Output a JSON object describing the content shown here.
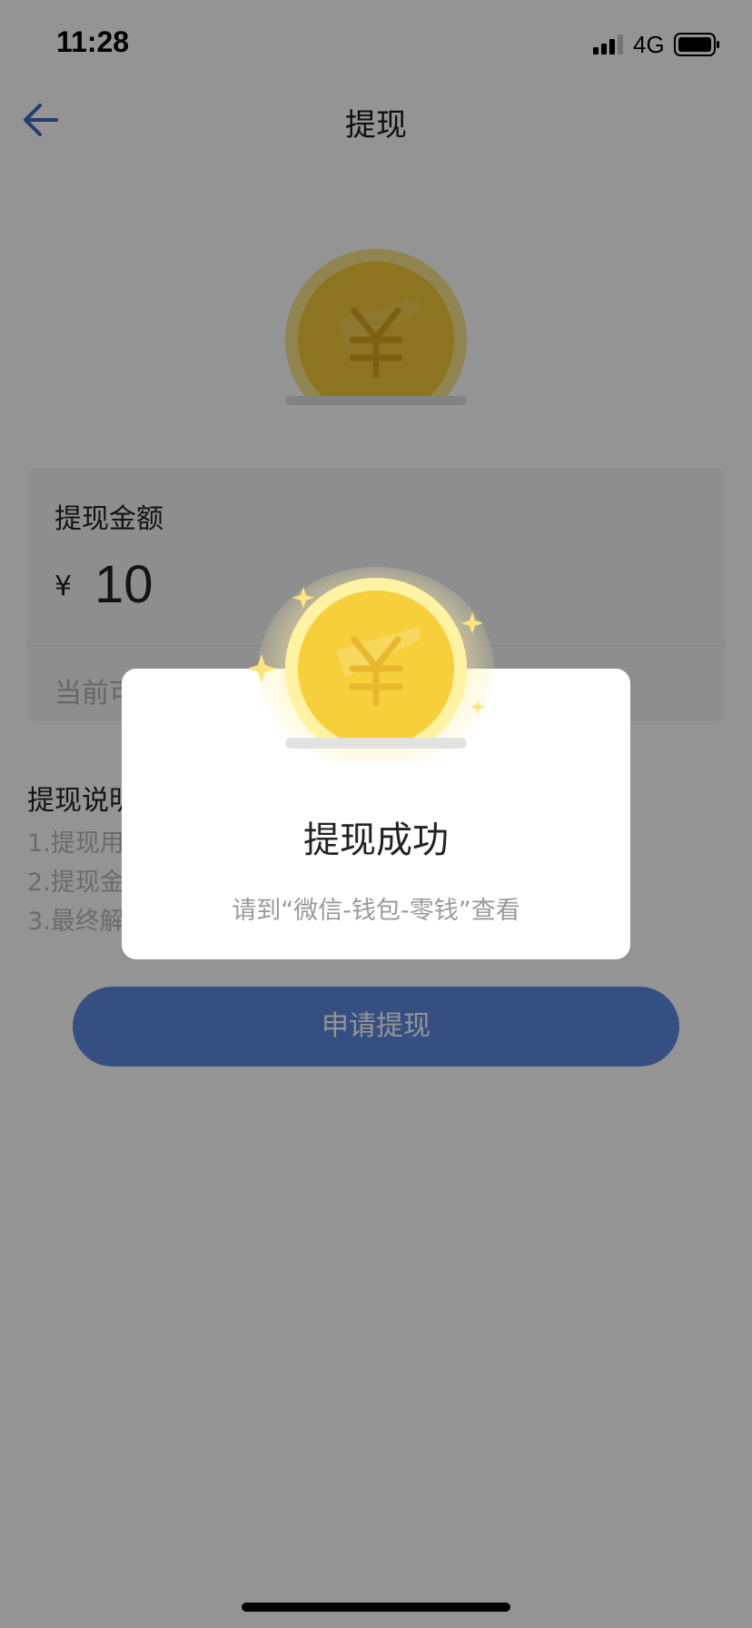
{
  "status_bar": {
    "time": "11:28",
    "network": "4G"
  },
  "nav": {
    "title": "提现",
    "back_icon": "arrow-left-icon"
  },
  "hero": {
    "icon": "yuan-coin-icon"
  },
  "amount_card": {
    "title": "提现金额",
    "currency_symbol": "¥",
    "amount": "10",
    "available_text": "当前可"
  },
  "notes": {
    "title": "提现说明",
    "lines": [
      "1.提现用",
      "2.提现金                                                          元；",
      "3.最终解"
    ]
  },
  "apply_button": {
    "label": "申请提现"
  },
  "modal": {
    "icon": "yuan-coin-sparkle-icon",
    "title": "提现成功",
    "subtitle": "请到“微信-钱包-零钱”查看"
  },
  "colors": {
    "primary": "#5d88e2",
    "coin": "#f7cf3c",
    "overlay": "rgba(0,0,0,0.42)"
  }
}
